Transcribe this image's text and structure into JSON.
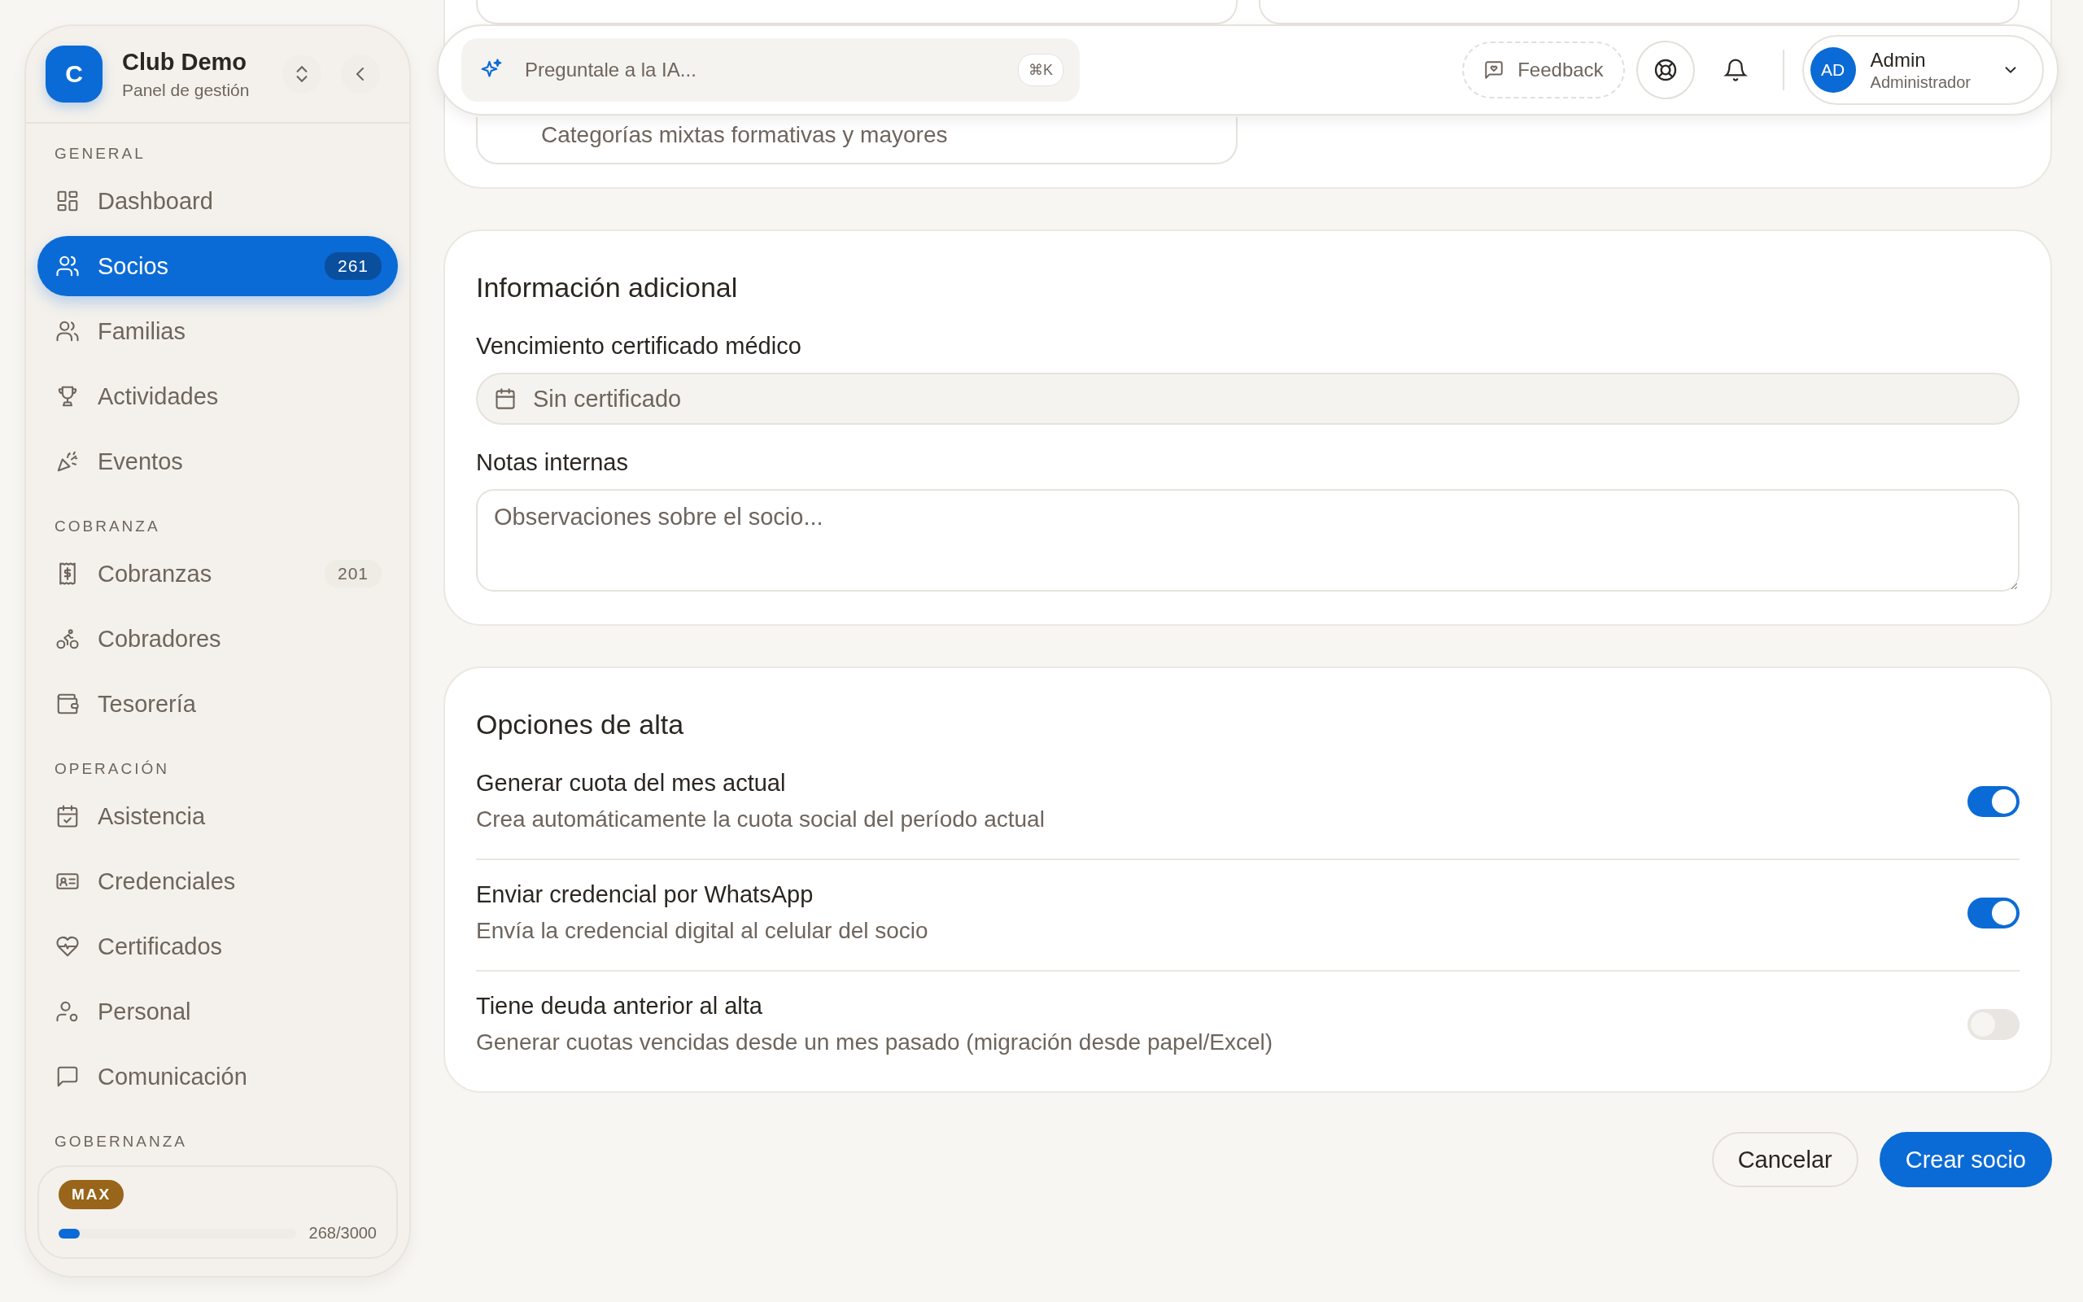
{
  "sidebar": {
    "brand": {
      "initial": "C",
      "name": "Club Demo",
      "subtitle": "Panel de gestión"
    },
    "sections": [
      {
        "title": "GENERAL",
        "items": [
          {
            "label": "Dashboard",
            "selected": false
          },
          {
            "label": "Socios",
            "badge": "261",
            "selected": true
          },
          {
            "label": "Familias",
            "selected": false
          },
          {
            "label": "Actividades",
            "selected": false
          },
          {
            "label": "Eventos",
            "selected": false
          }
        ]
      },
      {
        "title": "COBRANZA",
        "items": [
          {
            "label": "Cobranzas",
            "badge": "201",
            "selected": false
          },
          {
            "label": "Cobradores",
            "selected": false
          },
          {
            "label": "Tesorería",
            "selected": false
          }
        ]
      },
      {
        "title": "OPERACIÓN",
        "items": [
          {
            "label": "Asistencia",
            "selected": false
          },
          {
            "label": "Credenciales",
            "selected": false
          },
          {
            "label": "Certificados",
            "selected": false
          },
          {
            "label": "Personal",
            "selected": false
          },
          {
            "label": "Comunicación",
            "selected": false
          }
        ]
      },
      {
        "title": "GOBERNANZA"
      }
    ],
    "plan": {
      "badge": "MAX",
      "level": 0.09,
      "usage": "268/3000"
    }
  },
  "topbar": {
    "ask": {
      "placeholder": "Preguntale a la IA...",
      "shortcut": "⌘K"
    },
    "feedback": "Feedback",
    "user": {
      "initials": "AD",
      "name": "Admin",
      "role": "Administrador"
    }
  },
  "previous_card": {
    "field_value": "Categorías mixtas formativas y mayores"
  },
  "info_card": {
    "title": "Información adicional",
    "fields": [
      {
        "label": "Vencimiento certificado médico",
        "kind": "date",
        "placeholder": "Sin certificado"
      },
      {
        "label": "Notas internas",
        "kind": "textarea",
        "placeholder": "Observaciones sobre el socio..."
      }
    ]
  },
  "options_card": {
    "title": "Opciones de alta",
    "options": [
      {
        "label": "Generar cuota del mes actual",
        "description": "Crea automáticamente la cuota social del período actual",
        "on": true
      },
      {
        "label": "Enviar credencial por WhatsApp",
        "description": "Envía la credencial digital al celular del socio",
        "on": true
      },
      {
        "label": "Tiene deuda anterior al alta",
        "description": "Generar cuotas vencidas desde un mes pasado (migración desde papel/Excel)",
        "on": false
      }
    ]
  },
  "actions": [
    {
      "label": "Cancelar",
      "kind": "secondary"
    },
    {
      "label": "Crear socio",
      "kind": "primary"
    }
  ]
}
